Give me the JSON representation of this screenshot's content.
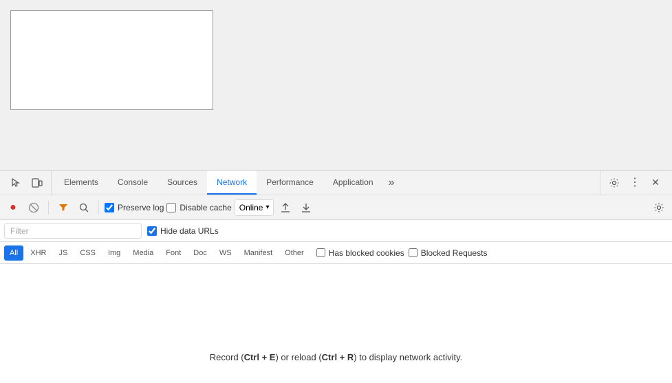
{
  "browser": {
    "content_area": "white rectangle placeholder"
  },
  "devtools": {
    "tabs": {
      "inspect_icon_label": "inspect",
      "device_icon_label": "device-toolbar",
      "items": [
        {
          "id": "elements",
          "label": "Elements",
          "active": false
        },
        {
          "id": "console",
          "label": "Console",
          "active": false
        },
        {
          "id": "sources",
          "label": "Sources",
          "active": false
        },
        {
          "id": "network",
          "label": "Network",
          "active": true
        },
        {
          "id": "performance",
          "label": "Performance",
          "active": false
        },
        {
          "id": "application",
          "label": "Application",
          "active": false
        }
      ],
      "more_label": "»",
      "settings_label": "⚙",
      "menu_label": "⋮",
      "close_label": "✕"
    },
    "toolbar": {
      "record_label": "●",
      "stop_label": "⊘",
      "filter_label": "▼",
      "search_label": "🔍",
      "preserve_log_label": "Preserve log",
      "preserve_log_checked": true,
      "disable_cache_label": "Disable cache",
      "disable_cache_checked": false,
      "online_label": "Online",
      "upload_label": "↑",
      "download_label": "↓",
      "settings_label": "⚙"
    },
    "filter_row": {
      "placeholder": "Filter",
      "hide_data_urls_label": "Hide data URLs",
      "hide_data_urls_checked": true
    },
    "filter_types": {
      "items": [
        {
          "id": "all",
          "label": "All",
          "active": true
        },
        {
          "id": "xhr",
          "label": "XHR",
          "active": false
        },
        {
          "id": "js",
          "label": "JS",
          "active": false
        },
        {
          "id": "css",
          "label": "CSS",
          "active": false
        },
        {
          "id": "img",
          "label": "Img",
          "active": false
        },
        {
          "id": "media",
          "label": "Media",
          "active": false
        },
        {
          "id": "font",
          "label": "Font",
          "active": false
        },
        {
          "id": "doc",
          "label": "Doc",
          "active": false
        },
        {
          "id": "ws",
          "label": "WS",
          "active": false
        },
        {
          "id": "manifest",
          "label": "Manifest",
          "active": false
        },
        {
          "id": "other",
          "label": "Other",
          "active": false
        }
      ],
      "has_blocked_cookies_label": "Has blocked cookies",
      "has_blocked_cookies_checked": false,
      "blocked_requests_label": "Blocked Requests",
      "blocked_requests_checked": false
    },
    "empty_state": {
      "text_before": "Record (",
      "shortcut1": "Ctrl + E",
      "text_middle": ") or reload (",
      "shortcut2": "Ctrl + R",
      "text_after": ") to display network activity."
    }
  }
}
